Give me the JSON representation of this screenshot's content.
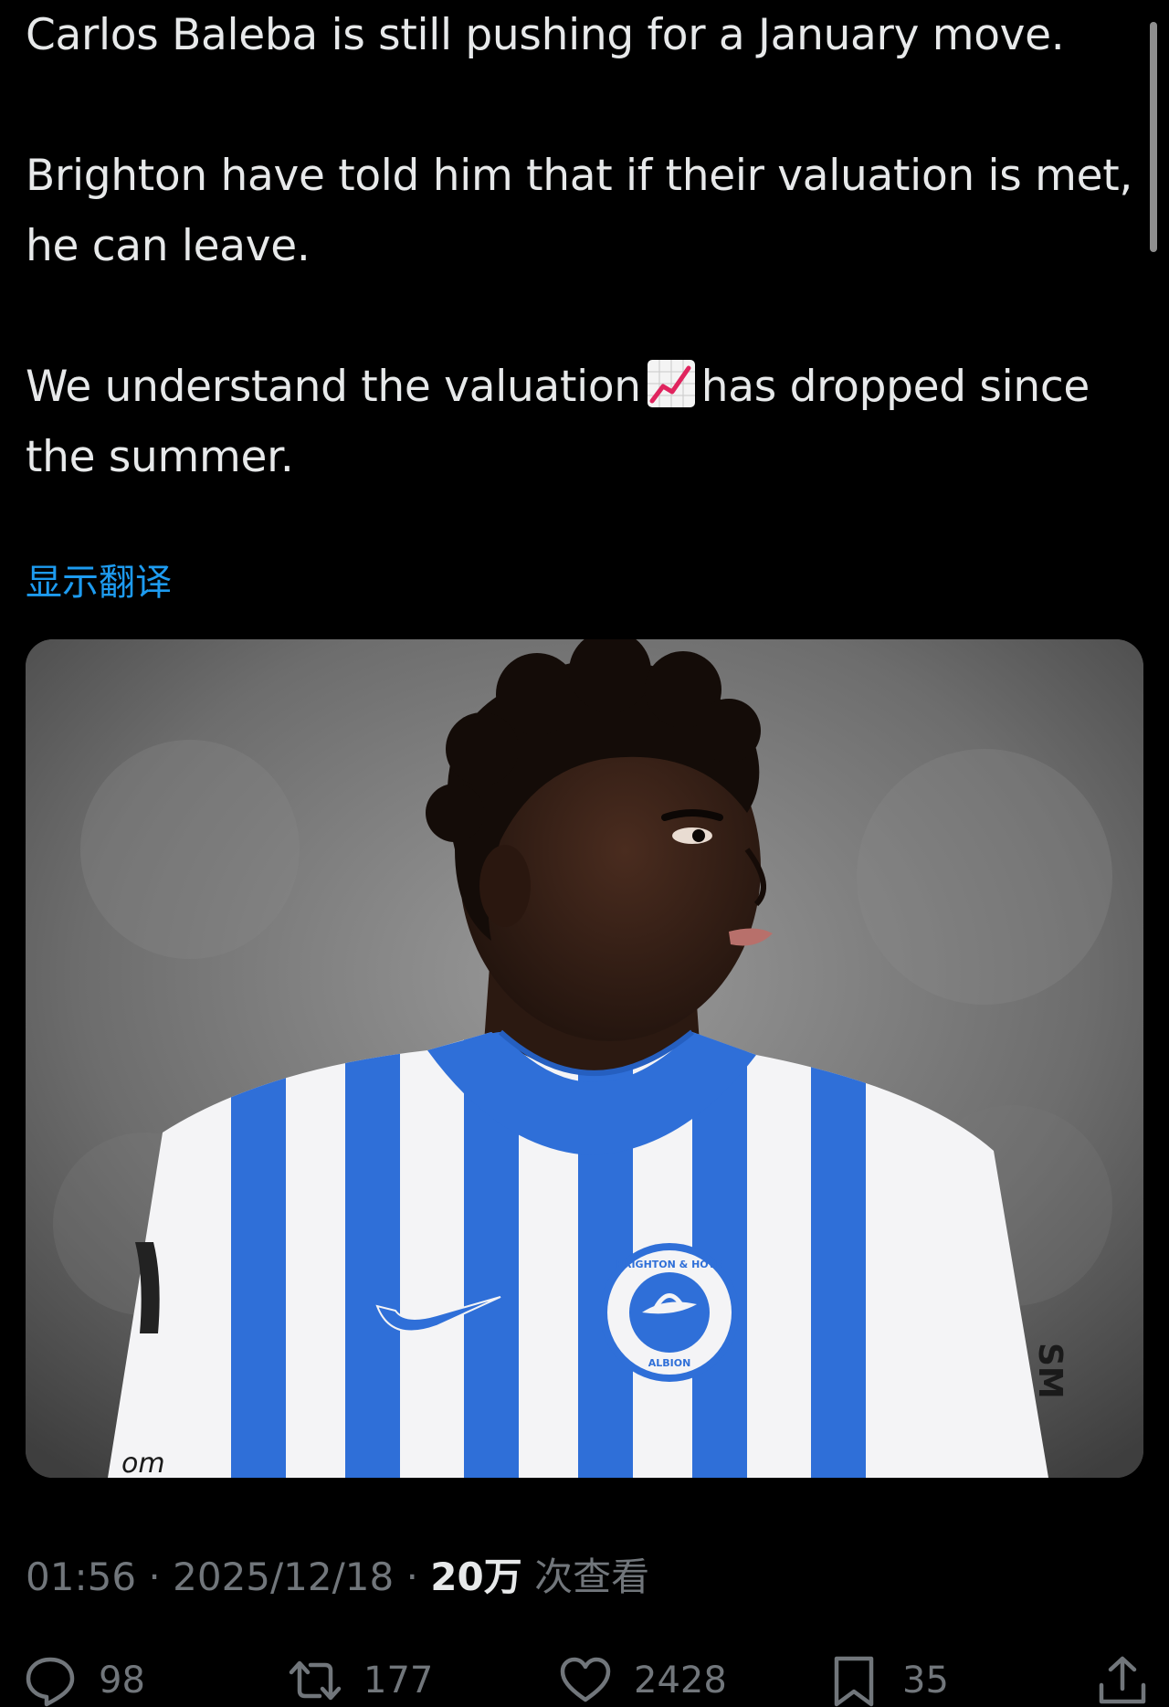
{
  "tweet": {
    "paragraph_1": "Carlos Baleba is still pushing for a January move.",
    "paragraph_2": "Brighton have told him that if their valuation is met, he can leave.",
    "paragraph_3_before_emoji": "We understand the valuation",
    "paragraph_3_emoji": "chart-increasing-emoji",
    "paragraph_3_after_emoji": "has dropped since the summer.",
    "translate_label": "显示翻译"
  },
  "media": {
    "alt_icon": "photo-player-brighton-kit",
    "crest_top_text": "BRIGHTON & HOVE",
    "crest_bottom_text": "ALBION",
    "sleeve_text": "om",
    "right_edge_text": "SM"
  },
  "meta": {
    "time": "01:56",
    "separator_1": "·",
    "date": "2025/12/18",
    "separator_2": "·",
    "views_count": "20万",
    "views_label": "次查看"
  },
  "actions": {
    "reply_count": "98",
    "retweet_count": "177",
    "like_count": "2428",
    "bookmark_count": "35"
  },
  "colors": {
    "background": "#000000",
    "text_primary": "#e7e9ea",
    "text_secondary": "#71767b",
    "link": "#1d9bf0",
    "kit_blue": "#2f6fd8"
  }
}
